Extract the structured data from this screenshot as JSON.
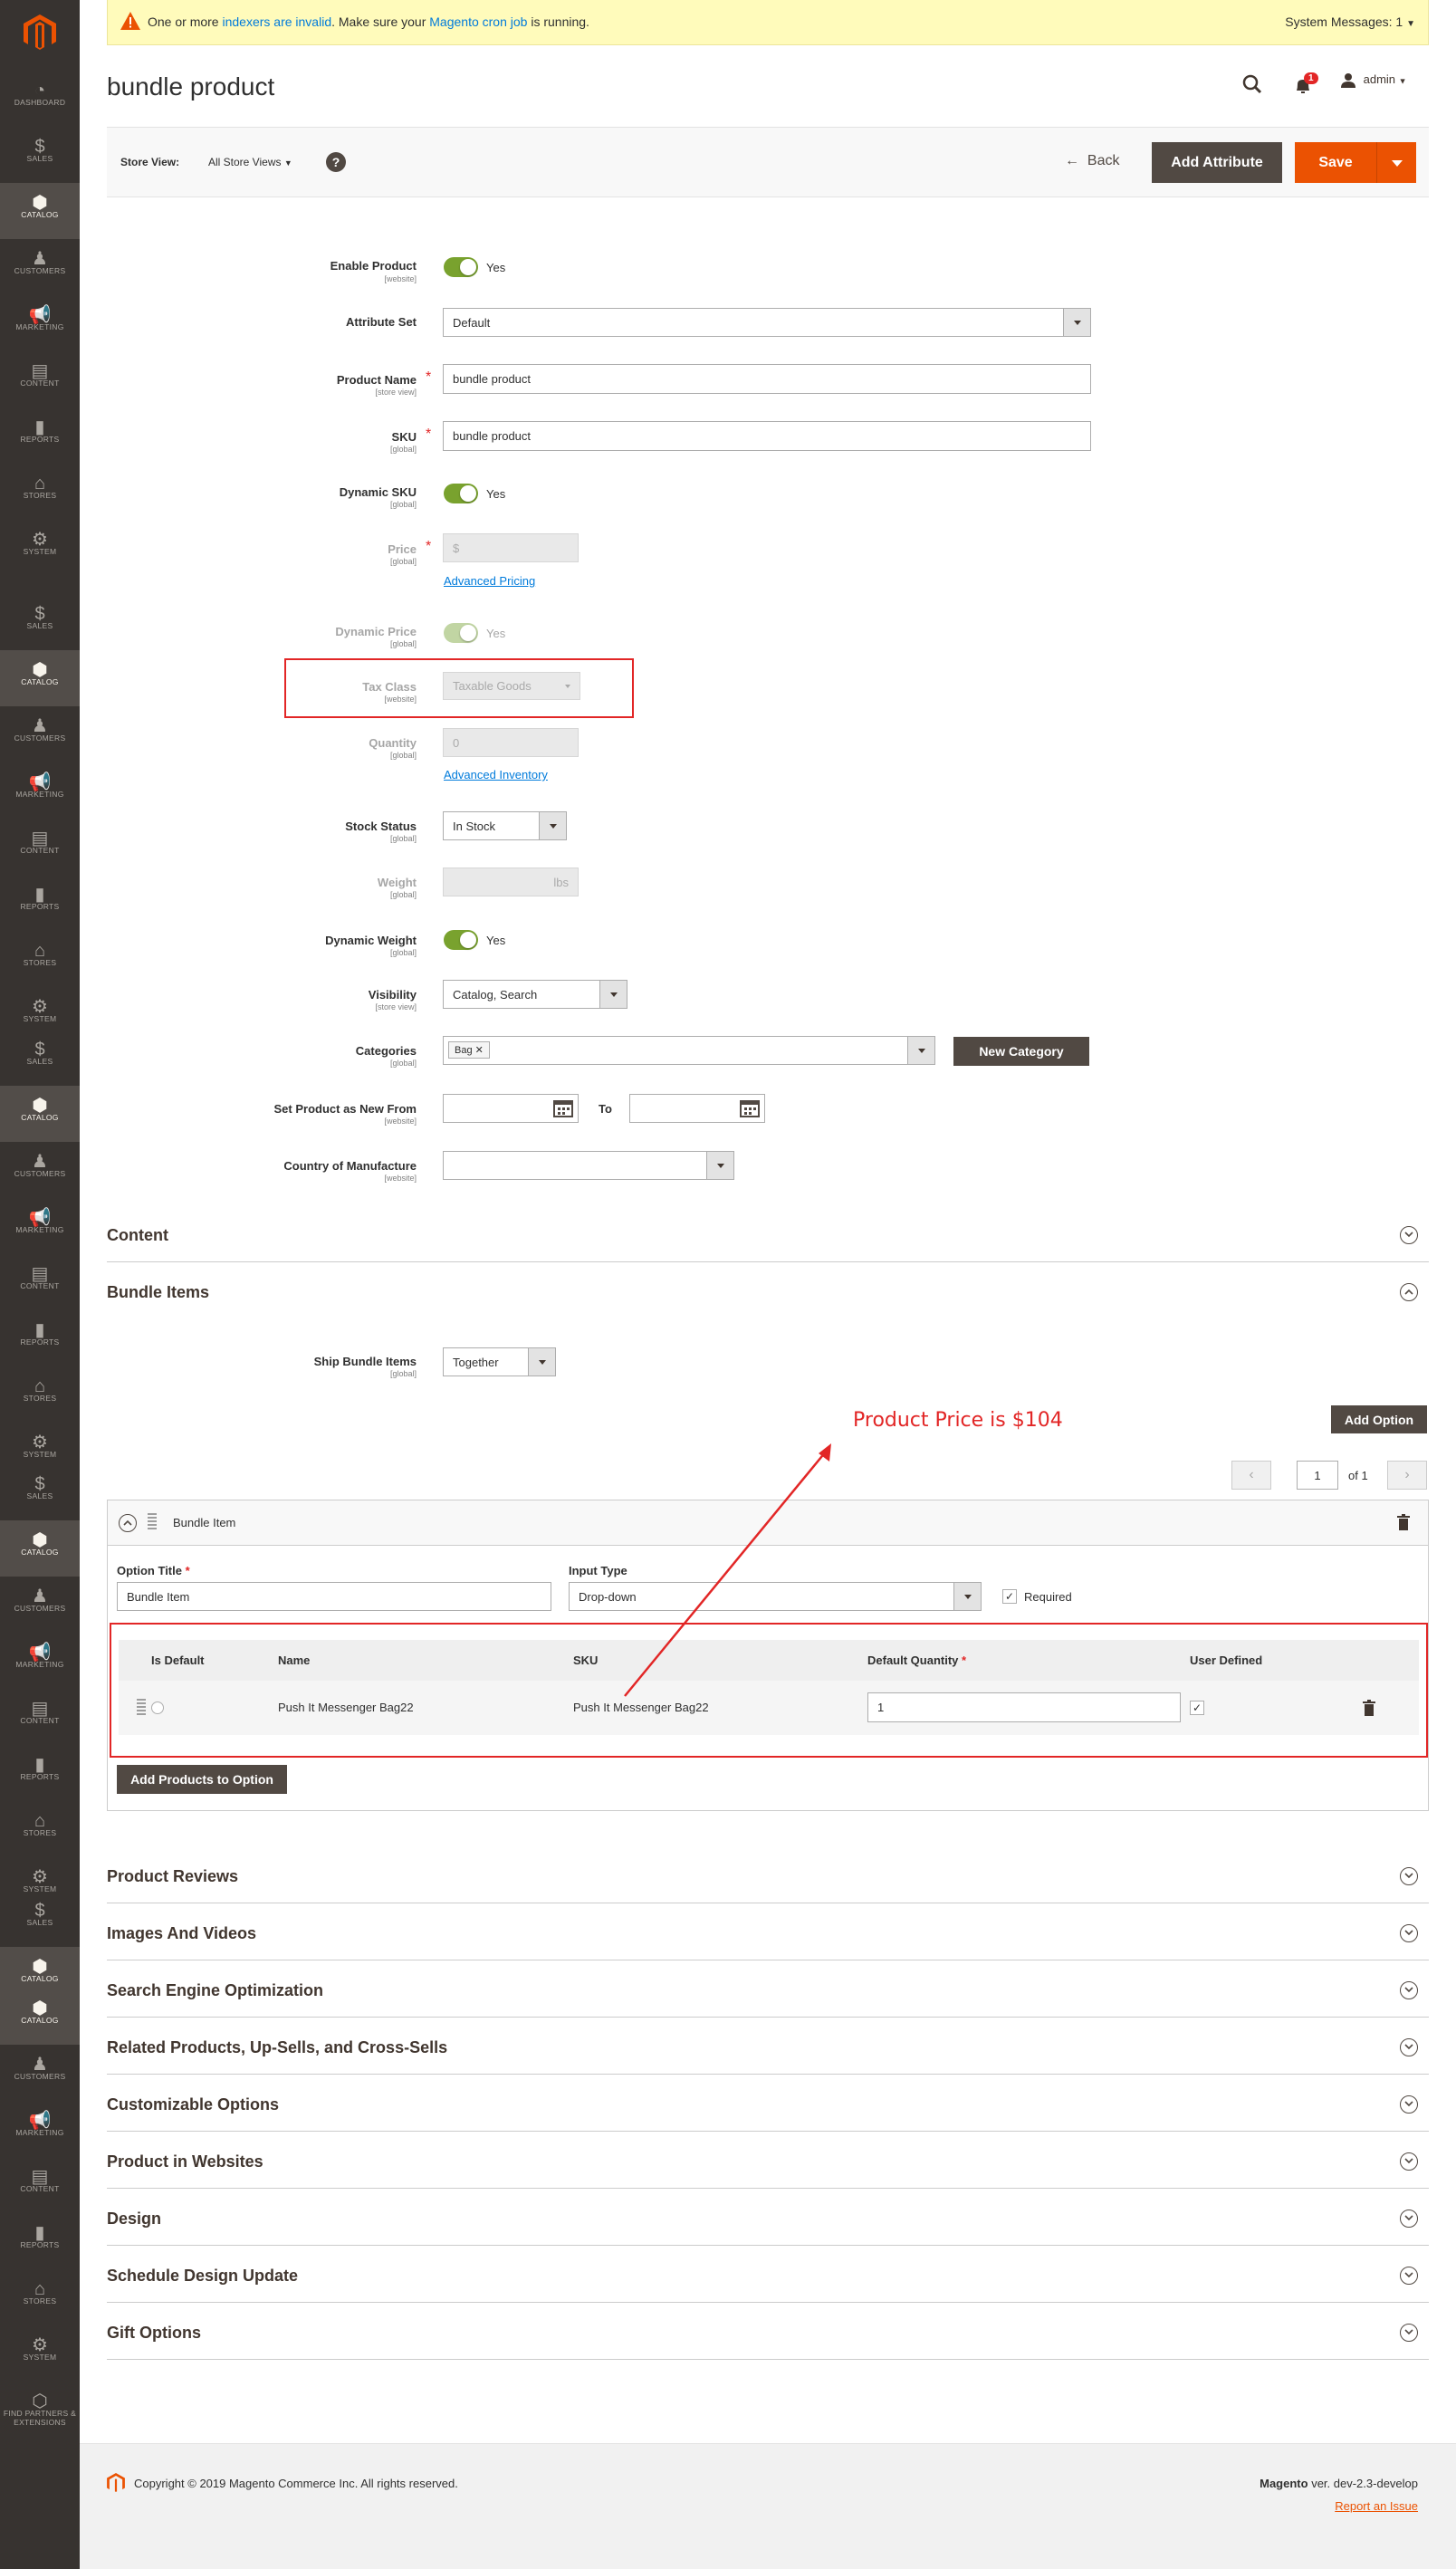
{
  "sidebar": {
    "groups": [
      [
        "DASHBOARD",
        "SALES",
        "CATALOG",
        "CUSTOMERS",
        "MARKETING",
        "CONTENT",
        "REPORTS",
        "STORES",
        "SYSTEM"
      ],
      [
        "SALES",
        "CATALOG",
        "CUSTOMERS",
        "MARKETING",
        "CONTENT",
        "REPORTS",
        "STORES",
        "SYSTEM"
      ],
      [
        "SALES",
        "CATALOG",
        "CUSTOMERS",
        "MARKETING",
        "CONTENT",
        "REPORTS",
        "STORES",
        "SYSTEM"
      ],
      [
        "SALES",
        "CATALOG",
        "CUSTOMERS",
        "MARKETING",
        "CONTENT",
        "REPORTS",
        "STORES",
        "SYSTEM"
      ],
      [
        "SALES",
        "CATALOG",
        "SALES"
      ],
      [
        "CATALOG",
        "CUSTOMERS",
        "MARKETING",
        "CONTENT",
        "REPORTS",
        "STORES",
        "SYSTEM",
        "FIND PARTNERS & EXTENSIONS"
      ]
    ],
    "active_label": "CATALOG"
  },
  "system_message": {
    "prefix": "One or more",
    "link1": "indexers are invalid",
    "middle": ". Make sure your",
    "link2": "Magento cron job",
    "suffix": "is running.",
    "counter": "System Messages: 1"
  },
  "header": {
    "title": "bundle product",
    "notification_count": "1",
    "user": "admin"
  },
  "toolbar": {
    "store_view_label": "Store View:",
    "store_view_value": "All Store Views",
    "back": "Back",
    "add_attribute": "Add Attribute",
    "save": "Save"
  },
  "form": {
    "enable_product": {
      "label": "Enable Product",
      "scope": "[website]",
      "value": "Yes"
    },
    "attribute_set": {
      "label": "Attribute Set",
      "value": "Default"
    },
    "product_name": {
      "label": "Product Name",
      "scope": "[store view]",
      "value": "bundle product"
    },
    "sku": {
      "label": "SKU",
      "scope": "[global]",
      "value": "bundle product"
    },
    "dynamic_sku": {
      "label": "Dynamic SKU",
      "scope": "[global]",
      "value": "Yes"
    },
    "price": {
      "label": "Price",
      "scope": "[global]",
      "value": "$",
      "link": "Advanced Pricing"
    },
    "dynamic_price": {
      "label": "Dynamic Price",
      "scope": "[global]",
      "value": "Yes"
    },
    "tax_class": {
      "label": "Tax Class",
      "scope": "[website]",
      "value": "Taxable Goods"
    },
    "quantity": {
      "label": "Quantity",
      "scope": "[global]",
      "value": "0",
      "link": "Advanced Inventory"
    },
    "stock_status": {
      "label": "Stock Status",
      "scope": "[global]",
      "value": "In Stock"
    },
    "weight": {
      "label": "Weight",
      "scope": "[global]",
      "unit": "lbs"
    },
    "dynamic_weight": {
      "label": "Dynamic Weight",
      "scope": "[global]",
      "value": "Yes"
    },
    "visibility": {
      "label": "Visibility",
      "scope": "[store view]",
      "value": "Catalog, Search"
    },
    "categories": {
      "label": "Categories",
      "scope": "[global]",
      "tag": "Bag",
      "new_button": "New Category"
    },
    "new_from": {
      "label": "Set Product as New From",
      "scope": "[website]",
      "to": "To"
    },
    "country": {
      "label": "Country of Manufacture",
      "scope": "[website]"
    }
  },
  "sections": {
    "content": "Content",
    "bundle_items": "Bundle Items",
    "after": [
      "Product Reviews",
      "Images And Videos",
      "Search Engine Optimization",
      "Related Products, Up-Sells, and Cross-Sells",
      "Customizable Options",
      "Product in Websites",
      "Design",
      "Schedule Design Update",
      "Gift Options"
    ]
  },
  "bundle": {
    "ship_label": "Ship Bundle Items",
    "ship_scope": "[global]",
    "ship_value": "Together",
    "add_option": "Add Option",
    "annotation": "Product Price is $104",
    "page": "1",
    "page_of": "of 1",
    "option_header": "Bundle Item",
    "option_title_label": "Option Title",
    "option_title_value": "Bundle Item",
    "input_type_label": "Input Type",
    "input_type_value": "Drop-down",
    "required_label": "Required",
    "columns": [
      "Is Default",
      "Name",
      "SKU",
      "Default Quantity",
      "User Defined"
    ],
    "row": {
      "name": "Push It Messenger Bag22",
      "sku": "Push It Messenger Bag22",
      "qty": "1"
    },
    "add_products": "Add Products to Option"
  },
  "footer": {
    "copyright": "Copyright © 2019 Magento Commerce Inc. All rights reserved.",
    "brand": "Magento",
    "version": "ver. dev-2.3-develop",
    "report": "Report an Issue"
  },
  "colors": {
    "accent": "#eb5202",
    "dark_button": "#514943",
    "link": "#007bdb",
    "annotation_red": "#e22626",
    "toggle_green": "#79a22e"
  }
}
